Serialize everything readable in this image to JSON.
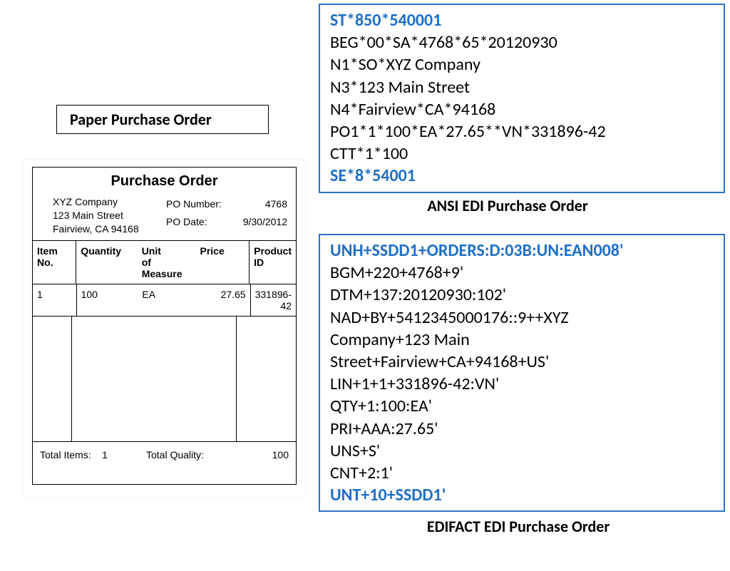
{
  "labels": {
    "paper_title": "Paper  Purchase Order",
    "ansi_caption": "ANSI EDI Purchase Order",
    "edifact_caption": "EDIFACT EDI Purchase Order"
  },
  "paper_po": {
    "title": "Purchase Order",
    "company": "XYZ Company",
    "street": "123 Main Street",
    "city_state_zip": "Fairview, CA 94168",
    "po_number_label": "PO Number:",
    "po_number": "4768",
    "po_date_label": "PO Date:",
    "po_date": "9/30/2012",
    "cols": {
      "item_l1": "Item",
      "item_l2": "No.",
      "qty": "Quantity",
      "uom_l1": "Unit",
      "uom_l2": "of Measure",
      "price": "Price",
      "pid": "Product ID"
    },
    "row": {
      "item": "1",
      "qty": "100",
      "uom": "EA",
      "price": "27.65",
      "pid": "331896-42"
    },
    "footer": {
      "total_items_label": "Total Items:",
      "total_items": "1",
      "total_quality_label": "Total Quality:",
      "total_quality": "100"
    }
  },
  "ansi": {
    "l1": "ST*850*540001",
    "l2": "BEG*00*SA*4768*65*20120930",
    "l3": "N1*SO*XYZ Company",
    "l4": "N3*123 Main Street",
    "l5": "N4*Fairview*CA*94168",
    "l6": "PO1*1*100*EA*27.65**VN*331896-42",
    "l7": "CTT*1*100",
    "l8": "SE*8*54001"
  },
  "edifact": {
    "l1": "UNH+SSDD1+ORDERS:D:03B:UN:EAN008'",
    "l2": "BGM+220+4768+9'",
    "l3": "DTM+137:20120930:102'",
    "l4": "NAD+BY+5412345000176::9++XYZ",
    "l5": "Company+123 Main",
    "l6": "Street+Fairview+CA+94168+US'",
    "l7": "LIN+1+1+331896-42:VN'",
    "l8": "QTY+1:100:EA'",
    "l9": "PRI+AAA:27.65'",
    "l10": "UNS+S'",
    "l11": "CNT+2:1'",
    "l12": "UNT+10+SSDD1'"
  }
}
